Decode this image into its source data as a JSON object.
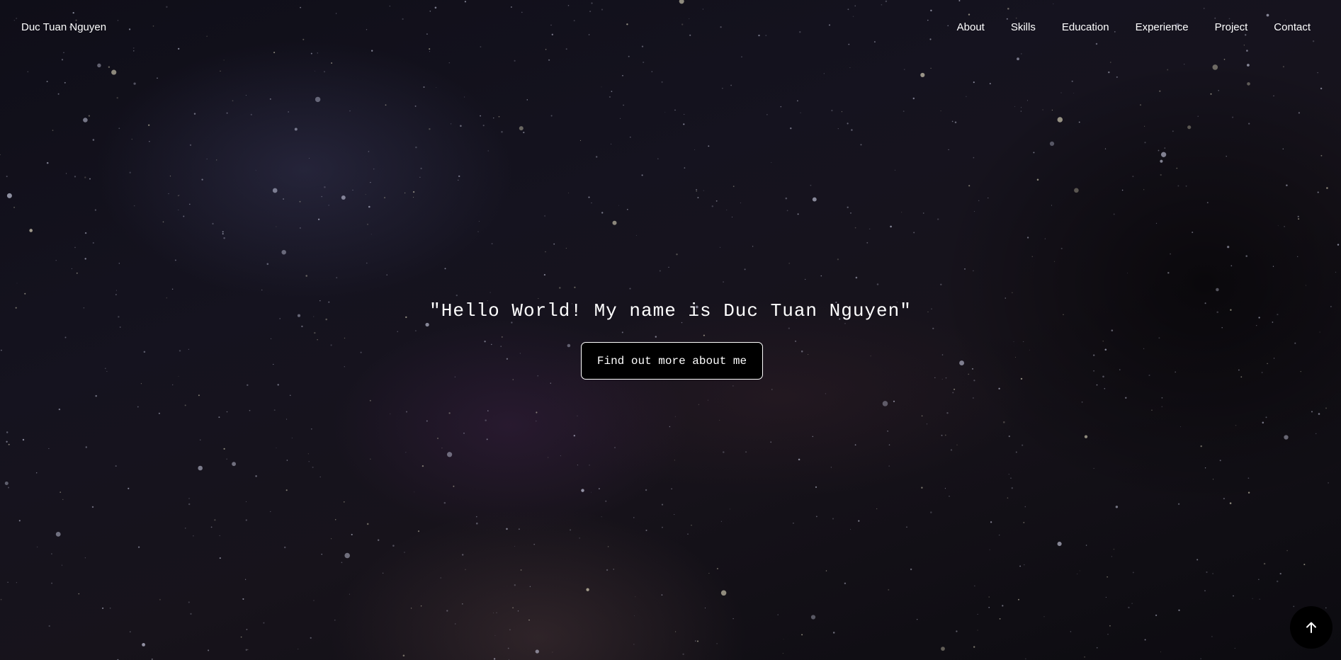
{
  "navbar": {
    "brand": "Duc Tuan Nguyen",
    "links": [
      "About",
      "Skills",
      "Education",
      "Experience",
      "Project",
      "Contact"
    ]
  },
  "hero": {
    "headline": "\"Hello World! My name is Duc Tuan Nguyen\"",
    "cta_label": "Find out more about me"
  },
  "scroll_top": {
    "icon": "arrow-up-icon"
  },
  "colors": {
    "text": "#ffffff",
    "button_bg": "#000000",
    "background": "#0b0a12"
  }
}
